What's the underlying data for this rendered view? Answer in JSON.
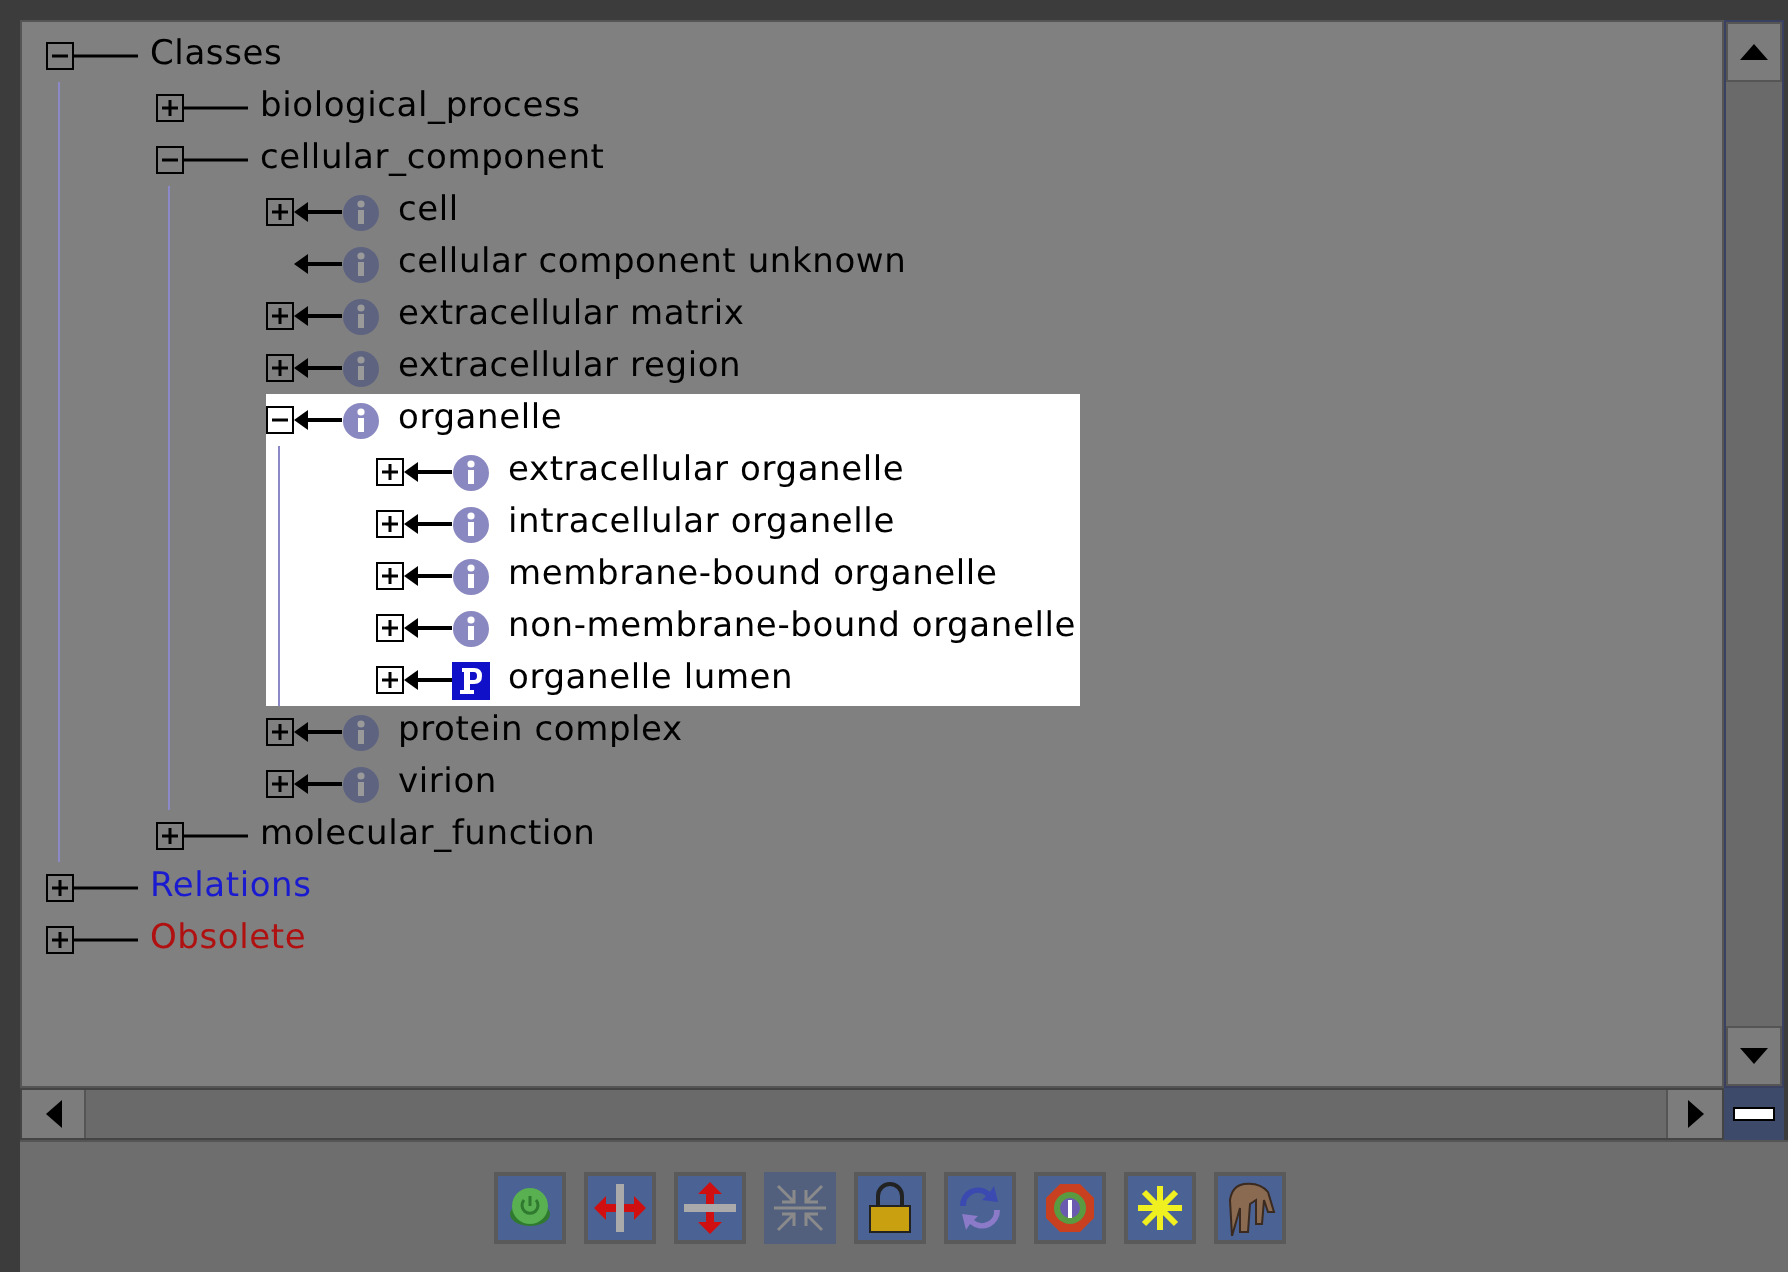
{
  "tree": [
    {
      "label": "Classes",
      "kind": "category",
      "expanded": true,
      "selected": false,
      "children": [
        {
          "label": "biological_process",
          "kind": "category",
          "expanded": false,
          "selected": false
        },
        {
          "label": "cellular_component",
          "kind": "category",
          "expanded": true,
          "selected": false,
          "children": [
            {
              "label": "cell",
              "kind": "class",
              "expanded": false,
              "selected": false
            },
            {
              "label": "cellular component unknown",
              "kind": "leaf-class",
              "selected": false
            },
            {
              "label": "extracellular matrix",
              "kind": "class",
              "expanded": false,
              "selected": false
            },
            {
              "label": "extracellular region",
              "kind": "class",
              "expanded": false,
              "selected": false
            },
            {
              "label": "organelle",
              "kind": "class",
              "expanded": true,
              "selected": true,
              "children": [
                {
                  "label": "extracellular organelle",
                  "kind": "class",
                  "expanded": false,
                  "selected": false
                },
                {
                  "label": "intracellular organelle",
                  "kind": "class",
                  "expanded": false,
                  "selected": false
                },
                {
                  "label": "membrane-bound organelle",
                  "kind": "class",
                  "expanded": false,
                  "selected": false
                },
                {
                  "label": "non-membrane-bound organelle",
                  "kind": "class",
                  "expanded": false,
                  "selected": false
                },
                {
                  "label": "organelle lumen",
                  "kind": "property",
                  "expanded": false,
                  "selected": false
                }
              ]
            },
            {
              "label": "protein complex",
              "kind": "class",
              "expanded": false,
              "selected": false
            },
            {
              "label": "virion",
              "kind": "class",
              "expanded": false,
              "selected": false
            }
          ]
        },
        {
          "label": "molecular_function",
          "kind": "category",
          "expanded": false,
          "selected": false
        }
      ]
    },
    {
      "label": "Relations",
      "kind": "category",
      "expanded": false,
      "selected": false,
      "color": "#1a1ad0"
    },
    {
      "label": "Obsolete",
      "kind": "category",
      "expanded": false,
      "selected": false,
      "color": "#b01010"
    }
  ],
  "toolbar": [
    {
      "kind": "power",
      "disabled": false
    },
    {
      "kind": "split-horizontal",
      "disabled": false
    },
    {
      "kind": "split-vertical",
      "disabled": false
    },
    {
      "kind": "collapse",
      "disabled": true
    },
    {
      "kind": "lock",
      "disabled": false
    },
    {
      "kind": "sync",
      "disabled": false
    },
    {
      "kind": "info",
      "disabled": false
    },
    {
      "kind": "star",
      "disabled": false
    },
    {
      "kind": "hand",
      "disabled": false
    }
  ]
}
